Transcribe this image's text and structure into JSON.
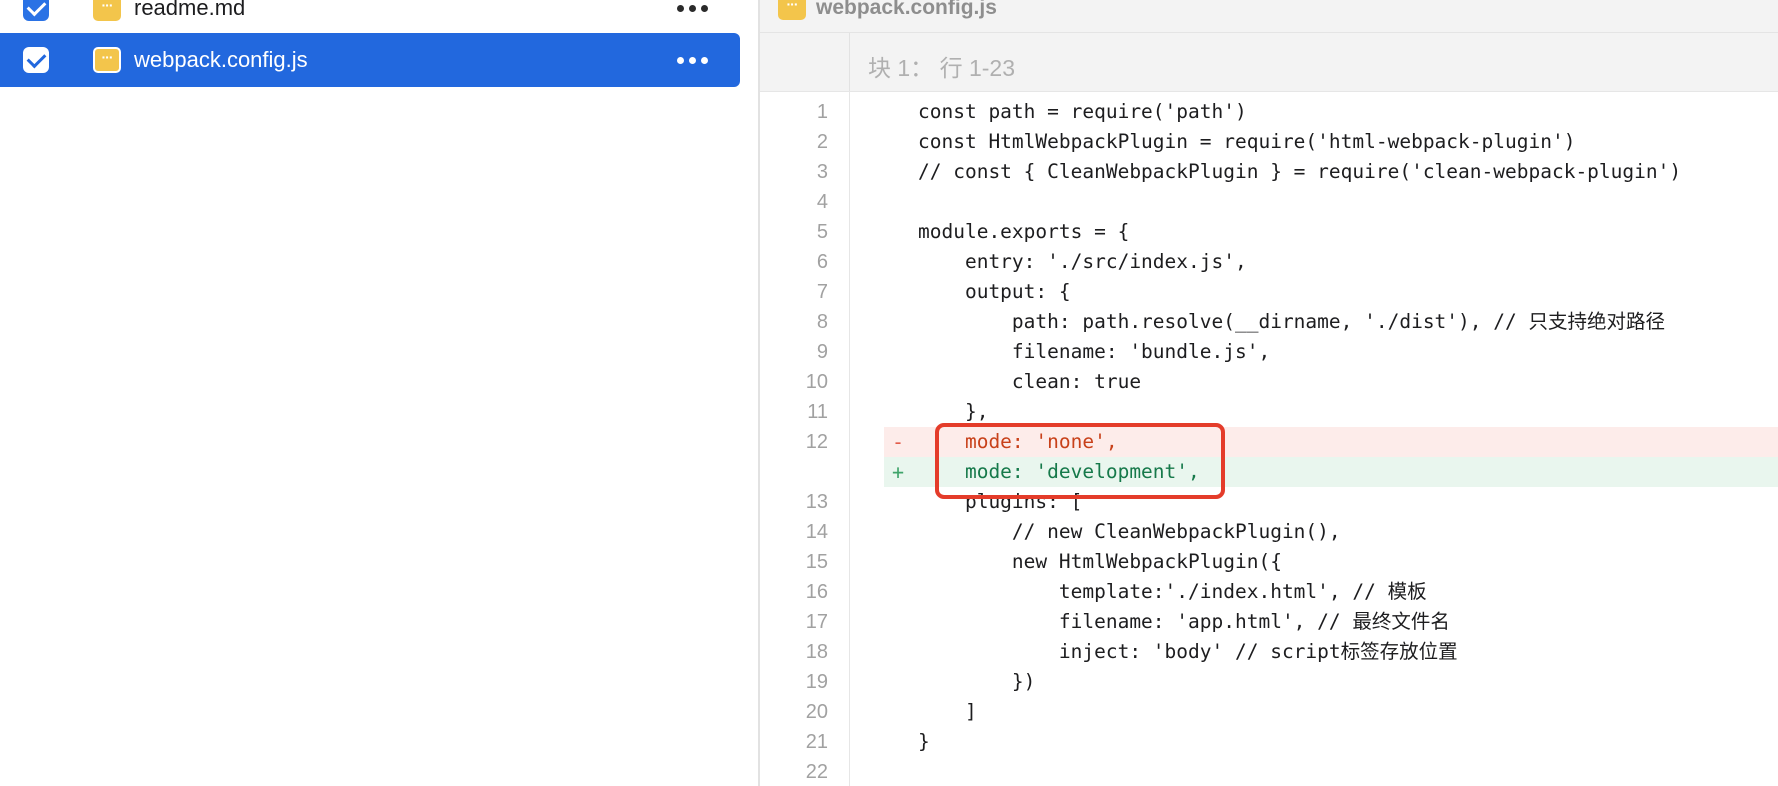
{
  "file_list": {
    "items": [
      {
        "name": "readme.md",
        "checked": true,
        "selected": false
      },
      {
        "name": "webpack.config.js",
        "checked": true,
        "selected": true
      }
    ]
  },
  "diff": {
    "file_name": "webpack.config.js",
    "hunk_label": "块 1： 行 1-23",
    "lines": [
      {
        "no": "1",
        "type": "context",
        "marker": "",
        "text": "const path = require('path')"
      },
      {
        "no": "2",
        "type": "context",
        "marker": "",
        "text": "const HtmlWebpackPlugin = require('html-webpack-plugin')"
      },
      {
        "no": "3",
        "type": "context",
        "marker": "",
        "text": "// const { CleanWebpackPlugin } = require('clean-webpack-plugin')"
      },
      {
        "no": "4",
        "type": "context",
        "marker": "",
        "text": ""
      },
      {
        "no": "5",
        "type": "context",
        "marker": "",
        "text": "module.exports = {"
      },
      {
        "no": "6",
        "type": "context",
        "marker": "",
        "text": "    entry: './src/index.js',"
      },
      {
        "no": "7",
        "type": "context",
        "marker": "",
        "text": "    output: {"
      },
      {
        "no": "8",
        "type": "context",
        "marker": "",
        "text": "        path: path.resolve(__dirname, './dist'), // 只支持绝对路径"
      },
      {
        "no": "9",
        "type": "context",
        "marker": "",
        "text": "        filename: 'bundle.js',"
      },
      {
        "no": "10",
        "type": "context",
        "marker": "",
        "text": "        clean: true"
      },
      {
        "no": "11",
        "type": "context",
        "marker": "",
        "text": "    },"
      },
      {
        "no": "12",
        "type": "removed",
        "marker": "-",
        "text": "    mode: 'none',"
      },
      {
        "no": "",
        "type": "added",
        "marker": "+",
        "text": "    mode: 'development',"
      },
      {
        "no": "13",
        "type": "context",
        "marker": "",
        "text": "    plugins: ["
      },
      {
        "no": "14",
        "type": "context",
        "marker": "",
        "text": "        // new CleanWebpackPlugin(),"
      },
      {
        "no": "15",
        "type": "context",
        "marker": "",
        "text": "        new HtmlWebpackPlugin({"
      },
      {
        "no": "16",
        "type": "context",
        "marker": "",
        "text": "            template:'./index.html', // 模板"
      },
      {
        "no": "17",
        "type": "context",
        "marker": "",
        "text": "            filename: 'app.html', // 最终文件名"
      },
      {
        "no": "18",
        "type": "context",
        "marker": "",
        "text": "            inject: 'body' // script标签存放位置"
      },
      {
        "no": "19",
        "type": "context",
        "marker": "",
        "text": "        })"
      },
      {
        "no": "20",
        "type": "context",
        "marker": "",
        "text": "    ]"
      },
      {
        "no": "21",
        "type": "context",
        "marker": "",
        "text": "}"
      },
      {
        "no": "22",
        "type": "context",
        "marker": "",
        "text": ""
      }
    ]
  },
  "colors": {
    "selection": "#2268de",
    "file_icon": "#f3c54b",
    "removed_bg": "#fdecea",
    "added_bg": "#e9f6ee",
    "annotation_box": "#e43c2a"
  }
}
